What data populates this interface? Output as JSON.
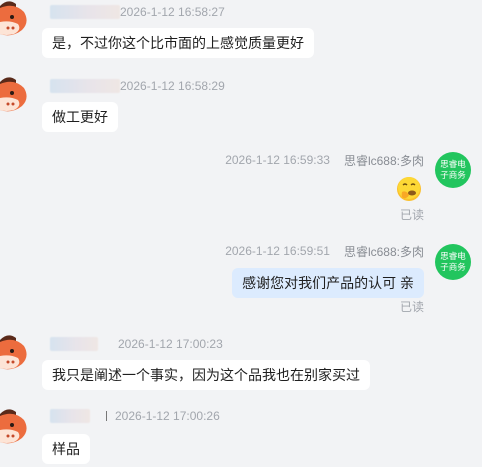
{
  "messages": [
    {
      "side": "left",
      "time": "2026-1-12 16:58:27",
      "text": "是，不过你这个比市面的上感觉质量更好"
    },
    {
      "side": "left",
      "time": "2026-1-12 16:58:29",
      "text": "做工更好"
    },
    {
      "side": "right",
      "sender": "思睿lc688:多肉",
      "time": "2026-1-12 16:59:33",
      "emoji": "thinking-face-emoji",
      "status": "已读"
    },
    {
      "side": "right",
      "sender": "思睿lc688:多肉",
      "time": "2026-1-12 16:59:51",
      "text": "感谢您对我们产品的认可 亲",
      "status": "已读"
    },
    {
      "side": "left",
      "time": "2026-1-12 17:00:23",
      "text": "我只是阐述一个事实，因为这个品我也在别家买过"
    },
    {
      "side": "left",
      "time": "2026-1-12 17:00:26",
      "text": "样品"
    }
  ],
  "agent_avatar": {
    "line1": "思睿电",
    "line2": "子商务",
    "color": "#22c55e"
  },
  "colors": {
    "background": "#f2f3f5",
    "bubble_left": "#ffffff",
    "bubble_right": "#dcebfe",
    "timestamp": "#a2a6ad"
  }
}
